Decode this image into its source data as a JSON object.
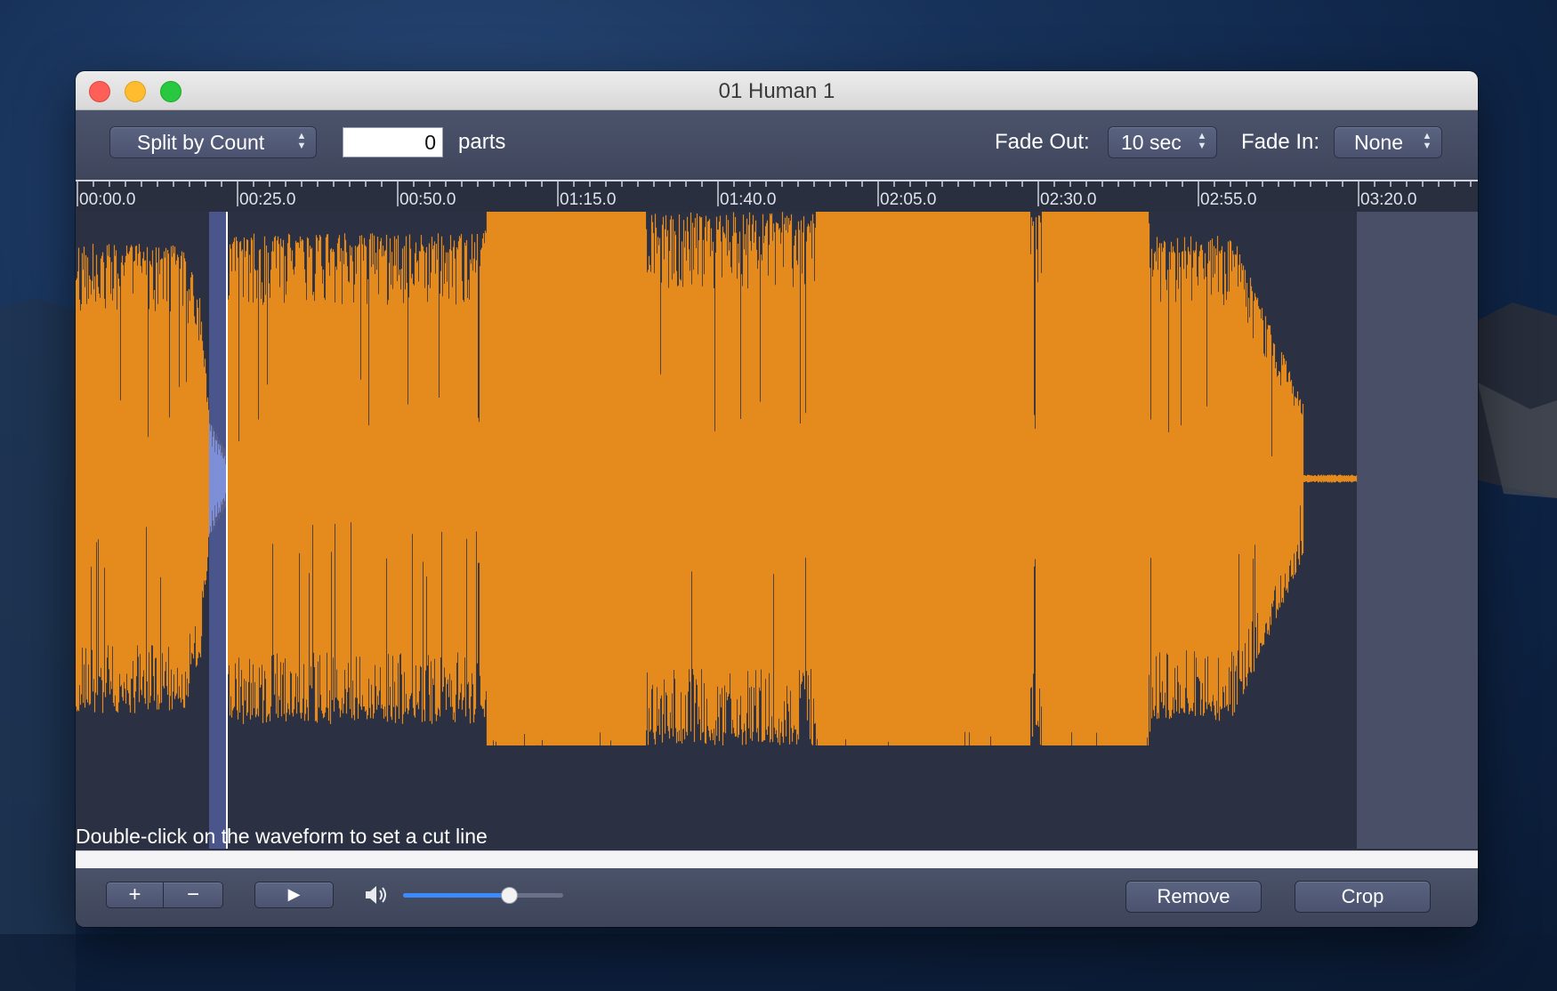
{
  "window": {
    "title": "01 Human 1"
  },
  "toolbar": {
    "split_mode": "Split by Count",
    "count_value": "0",
    "count_unit": "parts",
    "fade_out_label": "Fade Out:",
    "fade_out_value": "10 sec",
    "fade_in_label": "Fade In:",
    "fade_in_value": "None"
  },
  "timeline": {
    "ticks": [
      "00:00.0",
      "00:25.0",
      "00:50.0",
      "01:15.0",
      "01:40.0",
      "02:05.0",
      "02:30.0",
      "02:55.0",
      "03:20.0"
    ]
  },
  "waveform": {
    "color": "#e58b1e",
    "selection_color": "#4e5b94",
    "background": "#2b3042"
  },
  "hint": {
    "text": "Double-click on the waveform to set a cut line"
  },
  "controls": {
    "zoom_in_icon": "plus-icon",
    "zoom_out_icon": "minus-icon",
    "play_icon": "play-icon",
    "volume_icon": "speaker-icon",
    "volume_level": 0.66,
    "remove_label": "Remove",
    "crop_label": "Crop"
  }
}
